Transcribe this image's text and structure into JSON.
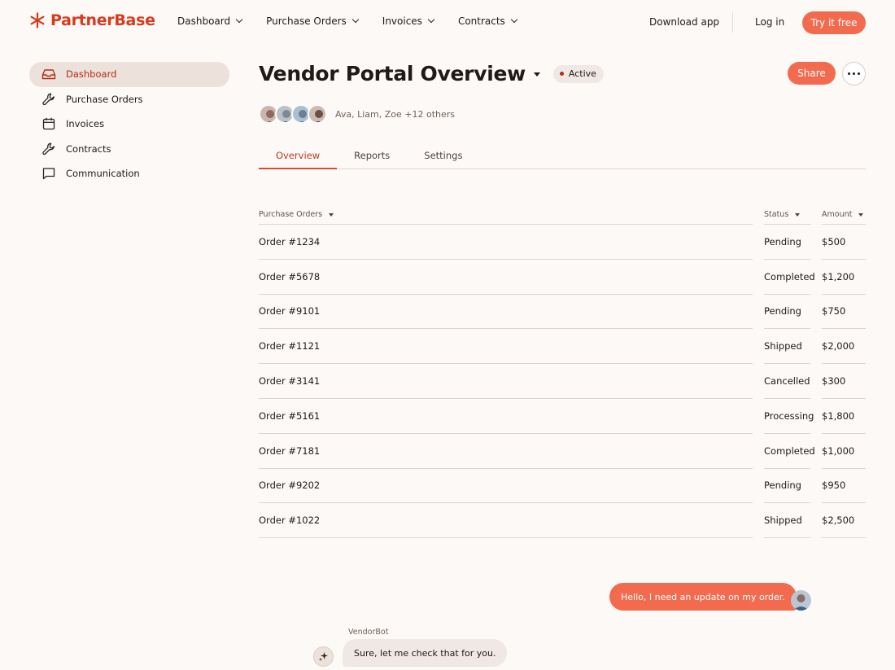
{
  "brand": {
    "name": "PartnerBase",
    "accent": "#f26b4f",
    "brand_color": "#d83a1c"
  },
  "topnav": {
    "menu": [
      {
        "label": "Dashboard",
        "icon": "chevron-down-icon"
      },
      {
        "label": "Purchase Orders",
        "icon": "chevron-down-icon"
      },
      {
        "label": "Invoices",
        "icon": "chevron-down-icon"
      },
      {
        "label": "Contracts",
        "icon": "chevron-down-icon"
      }
    ],
    "download_label": "Download app",
    "login_label": "Log in",
    "try_label": "Try it free"
  },
  "sidebar": {
    "items": [
      {
        "label": "Dashboard",
        "icon": "inbox-icon",
        "active": true
      },
      {
        "label": "Purchase Orders",
        "icon": "wrench-icon",
        "active": false
      },
      {
        "label": "Invoices",
        "icon": "calendar-icon",
        "active": false
      },
      {
        "label": "Contracts",
        "icon": "wrench-icon",
        "active": false
      },
      {
        "label": "Communication",
        "icon": "chat-bubble-icon",
        "active": false
      }
    ]
  },
  "header": {
    "title": "Vendor Portal Overview",
    "status": "Active",
    "share_label": "Share",
    "collaborators": "Ava, Liam, Zoe +12 others"
  },
  "tabs": [
    {
      "label": "Overview",
      "active": true
    },
    {
      "label": "Reports",
      "active": false
    },
    {
      "label": "Settings",
      "active": false
    }
  ],
  "table": {
    "columns": [
      "Purchase Orders",
      "Status",
      "Amount"
    ],
    "rows": [
      {
        "order": "Order #1234",
        "status": "Pending",
        "amount": "$500"
      },
      {
        "order": "Order #5678",
        "status": "Completed",
        "amount": "$1,200"
      },
      {
        "order": "Order #9101",
        "status": "Pending",
        "amount": "$750"
      },
      {
        "order": "Order #1121",
        "status": "Shipped",
        "amount": "$2,000"
      },
      {
        "order": "Order #3141",
        "status": "Cancelled",
        "amount": "$300"
      },
      {
        "order": "Order #5161",
        "status": "Processing",
        "amount": "$1,800"
      },
      {
        "order": "Order #7181",
        "status": "Completed",
        "amount": "$1,000"
      },
      {
        "order": "Order #9202",
        "status": "Pending",
        "amount": "$950"
      },
      {
        "order": "Order #1022",
        "status": "Shipped",
        "amount": "$2,500"
      }
    ]
  },
  "chat": {
    "user_message": "Hello, I need an update on my order.",
    "bot_name": "VendorBot",
    "bot_message": "Sure, let me check that for you."
  }
}
